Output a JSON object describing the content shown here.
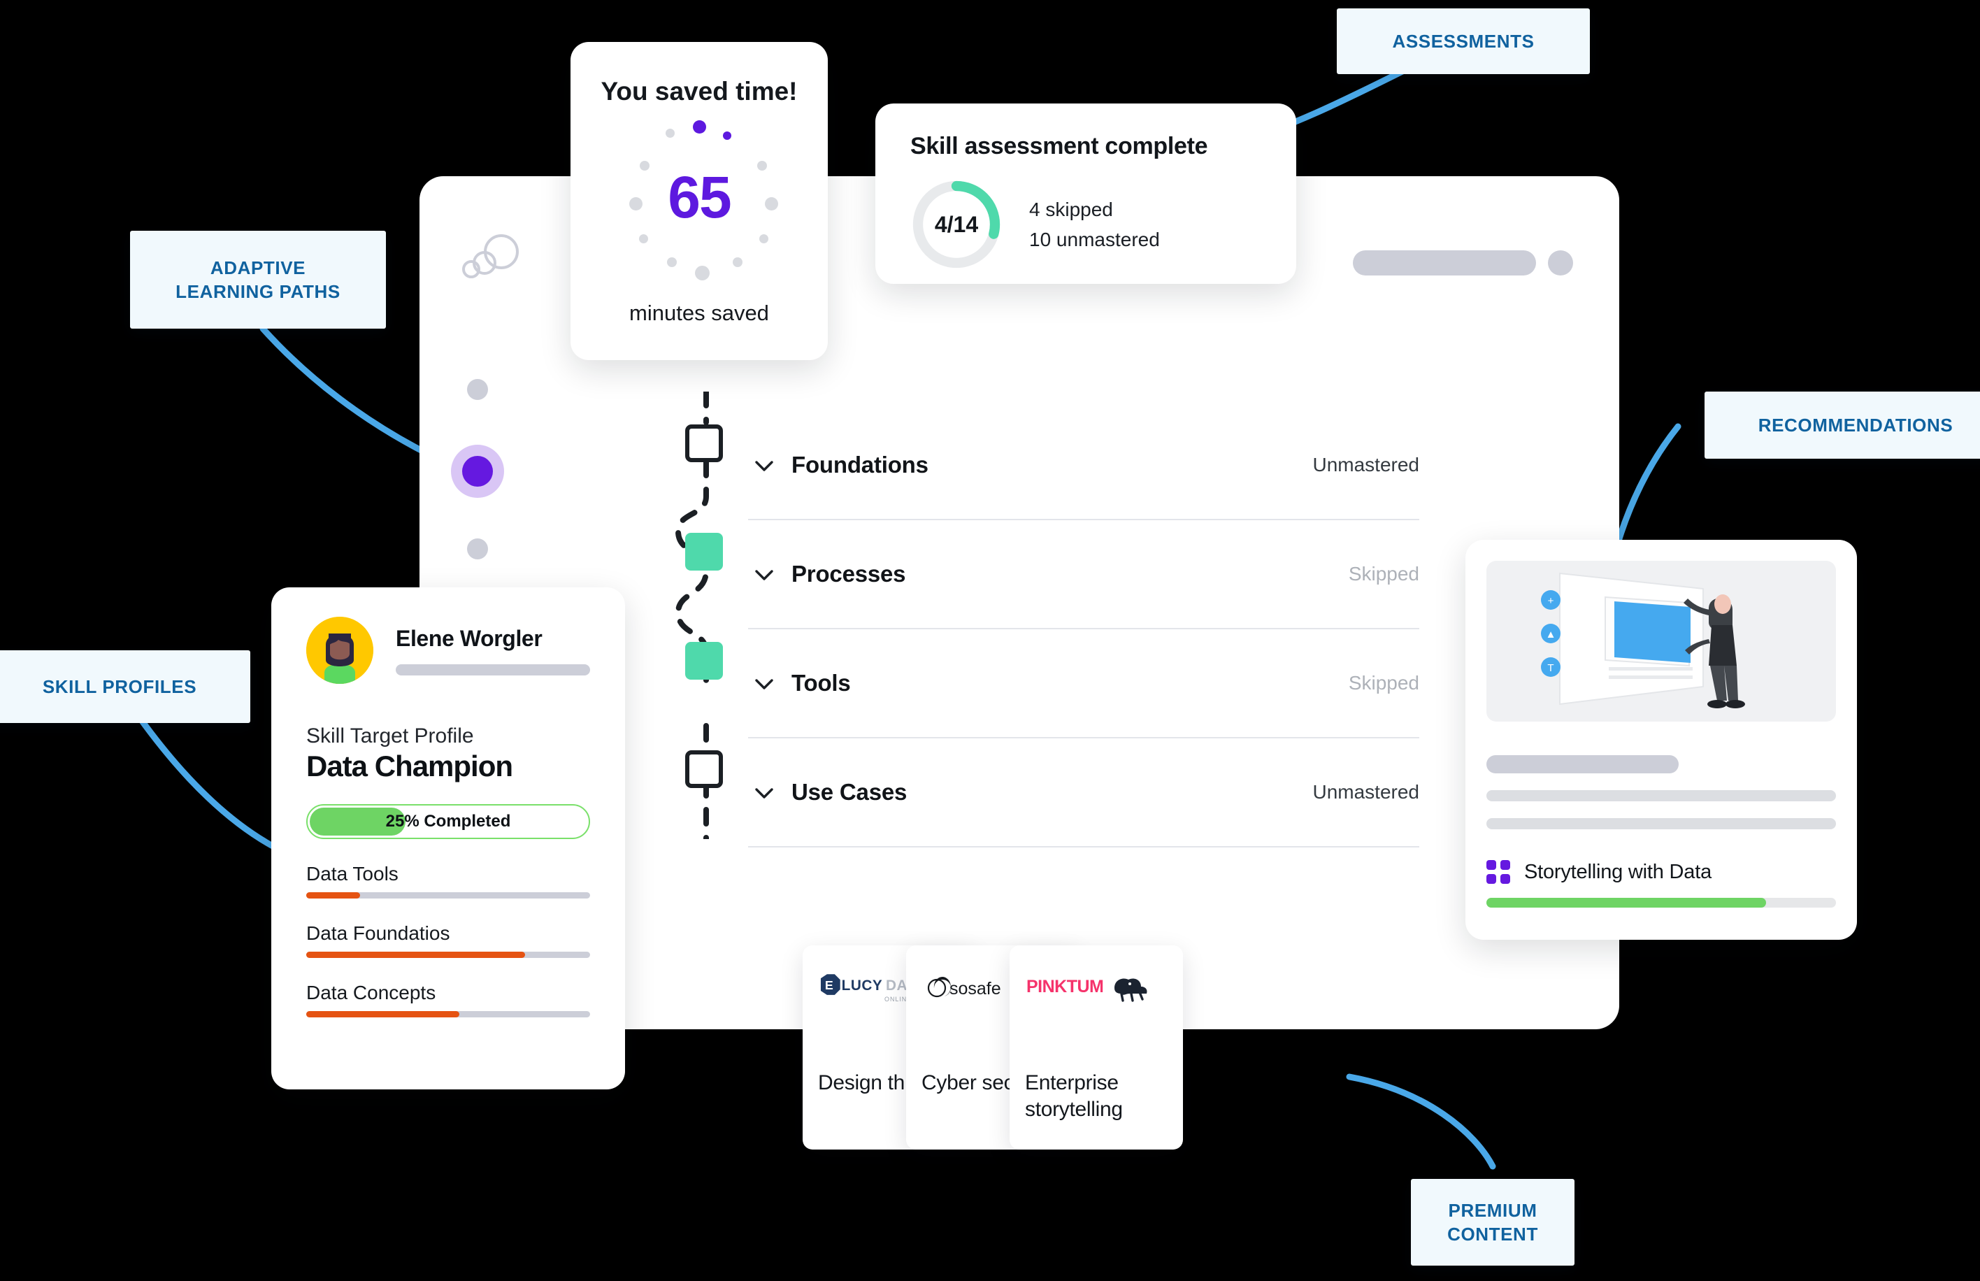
{
  "callouts": [
    {
      "id": "assessments",
      "label": "ASSESSMENTS"
    },
    {
      "id": "adaptive",
      "label": "ADAPTIVE\nLEARNING PATHS"
    },
    {
      "id": "recommendations",
      "label": "RECOMMENDATIONS"
    },
    {
      "id": "skill_profiles",
      "label": "SKILL PROFILES"
    },
    {
      "id": "premium",
      "label": "PREMIUM\nCONTENT"
    }
  ],
  "saved_time_card": {
    "title": "You saved time!",
    "value": "65",
    "subtitle": "minutes saved",
    "accent_color": "#5d19df"
  },
  "assessment_card": {
    "title": "Skill assessment complete",
    "donut_label": "4/14",
    "donut_percent": 29,
    "donut_color": "#4fd9ab",
    "lines": [
      "4 skipped",
      "10 unmastered"
    ]
  },
  "profile_card": {
    "name": "Elene Worgler",
    "section_label": "Skill Target Profile",
    "profile_title": "Data Champion",
    "progress_label": "25% Completed",
    "progress_percent": 25,
    "skills": [
      {
        "label": "Data Tools",
        "percent": 19
      },
      {
        "label": "Data Foundatios",
        "percent": 77
      },
      {
        "label": "Data Concepts",
        "percent": 54
      }
    ]
  },
  "recommendation_card": {
    "course_name": "Storytelling with Data",
    "progress_percent": 80,
    "icon": "grid-icon"
  },
  "skill_list": [
    {
      "name": "Foundations",
      "status": "Unmastered",
      "skipped": false,
      "node": "box"
    },
    {
      "name": "Processes",
      "status": "Skipped",
      "skipped": true,
      "node": "green"
    },
    {
      "name": "Tools",
      "status": "Skipped",
      "skipped": true,
      "node": "green"
    },
    {
      "name": "Use Cases",
      "status": "Unmastered",
      "skipped": false,
      "node": "box"
    }
  ],
  "content_cards": [
    {
      "logo": "LUCYDATE",
      "logo_sub": "ONLINE TRAINING",
      "title": "Design\nthinking"
    },
    {
      "logo": "sosafe",
      "logo_sub": "",
      "title": "Cyber\nsecurity"
    },
    {
      "logo": "PINKTUM",
      "logo_sub": "",
      "title": "Enterprise\nstorytelling"
    }
  ],
  "colors": {
    "purple": "#6519e0",
    "green": "#4fd9ab",
    "orange": "#e55312",
    "callout_text": "#10629f",
    "callout_bg": "#f1f9fd",
    "connector": "#4aa8e8"
  }
}
